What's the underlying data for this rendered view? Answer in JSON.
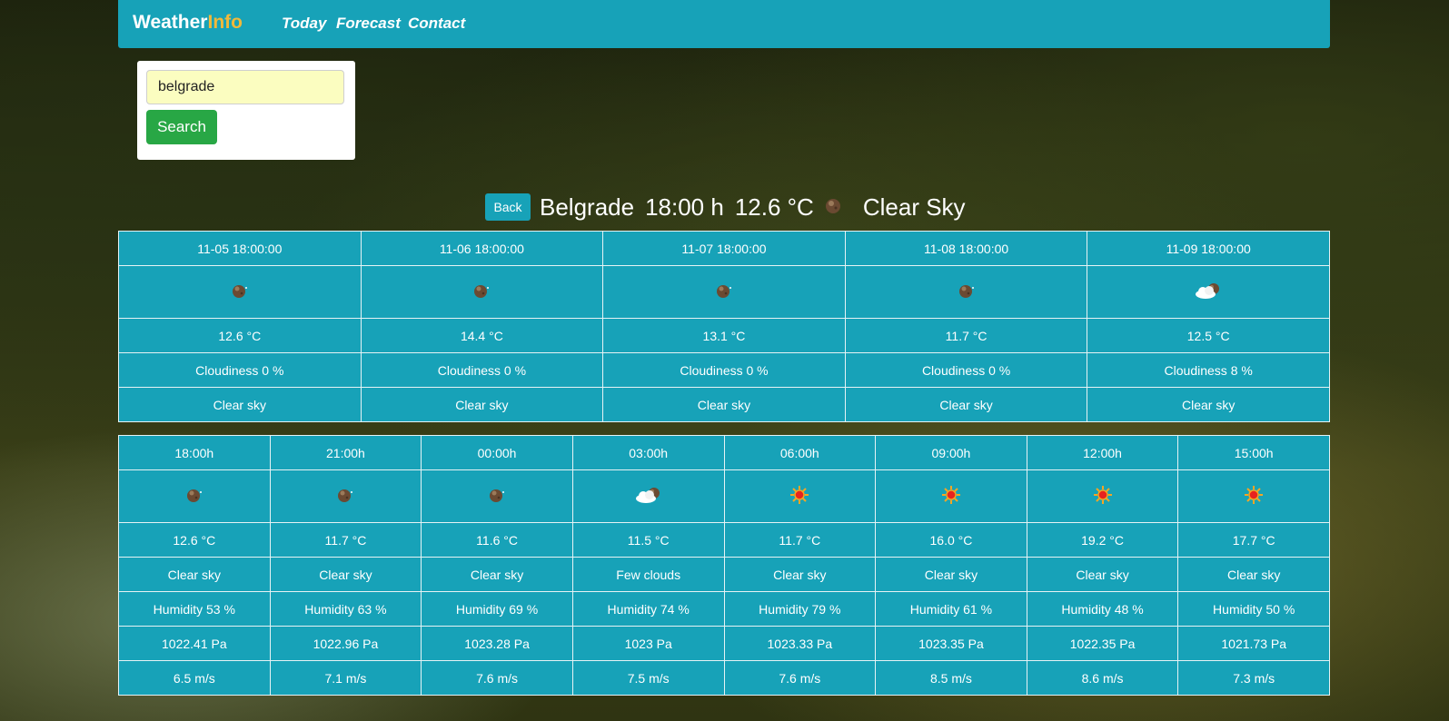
{
  "nav": {
    "brand_main": "Weather",
    "brand_accent": "Info",
    "links": [
      "Today",
      "Forecast",
      "Contact"
    ]
  },
  "search": {
    "value": "belgrade",
    "button_label": "Search"
  },
  "current": {
    "back_label": "Back",
    "city": "Belgrade",
    "time": "18:00 h",
    "temp": "12.6 °C",
    "icon": "moon-night-icon",
    "description": "Clear Sky"
  },
  "daily": [
    {
      "datetime": "11-05 18:00:00",
      "icon": "moon-night-icon",
      "temp": "12.6 °C",
      "cloudiness": "Cloudiness 0 %",
      "desc": "Clear sky"
    },
    {
      "datetime": "11-06 18:00:00",
      "icon": "moon-night-icon",
      "temp": "14.4 °C",
      "cloudiness": "Cloudiness 0 %",
      "desc": "Clear sky"
    },
    {
      "datetime": "11-07 18:00:00",
      "icon": "moon-night-icon",
      "temp": "13.1 °C",
      "cloudiness": "Cloudiness 0 %",
      "desc": "Clear sky"
    },
    {
      "datetime": "11-08 18:00:00",
      "icon": "moon-night-icon",
      "temp": "11.7 °C",
      "cloudiness": "Cloudiness 0 %",
      "desc": "Clear sky"
    },
    {
      "datetime": "11-09 18:00:00",
      "icon": "cloud-moon-icon",
      "temp": "12.5 °C",
      "cloudiness": "Cloudiness 8 %",
      "desc": "Clear sky"
    }
  ],
  "hourly": [
    {
      "time": "18:00h",
      "icon": "moon-night-icon",
      "temp": "12.6 °C",
      "desc": "Clear sky",
      "humidity": "Humidity 53 %",
      "pressure": "1022.41 Pa",
      "wind": "6.5 m/s"
    },
    {
      "time": "21:00h",
      "icon": "moon-night-icon",
      "temp": "11.7 °C",
      "desc": "Clear sky",
      "humidity": "Humidity 63 %",
      "pressure": "1022.96 Pa",
      "wind": "7.1 m/s"
    },
    {
      "time": "00:00h",
      "icon": "moon-night-icon",
      "temp": "11.6 °C",
      "desc": "Clear sky",
      "humidity": "Humidity 69 %",
      "pressure": "1023.28 Pa",
      "wind": "7.6 m/s"
    },
    {
      "time": "03:00h",
      "icon": "cloud-moon-icon",
      "temp": "11.5 °C",
      "desc": "Few clouds",
      "humidity": "Humidity 74 %",
      "pressure": "1023 Pa",
      "wind": "7.5 m/s"
    },
    {
      "time": "06:00h",
      "icon": "sun-icon",
      "temp": "11.7 °C",
      "desc": "Clear sky",
      "humidity": "Humidity 79 %",
      "pressure": "1023.33 Pa",
      "wind": "7.6 m/s"
    },
    {
      "time": "09:00h",
      "icon": "sun-icon",
      "temp": "16.0 °C",
      "desc": "Clear sky",
      "humidity": "Humidity 61 %",
      "pressure": "1023.35 Pa",
      "wind": "8.5 m/s"
    },
    {
      "time": "12:00h",
      "icon": "sun-icon",
      "temp": "19.2 °C",
      "desc": "Clear sky",
      "humidity": "Humidity 48 %",
      "pressure": "1022.35 Pa",
      "wind": "8.6 m/s"
    },
    {
      "time": "15:00h",
      "icon": "sun-icon",
      "temp": "17.7 °C",
      "desc": "Clear sky",
      "humidity": "Humidity 50 %",
      "pressure": "1021.73 Pa",
      "wind": "7.3 m/s"
    }
  ]
}
